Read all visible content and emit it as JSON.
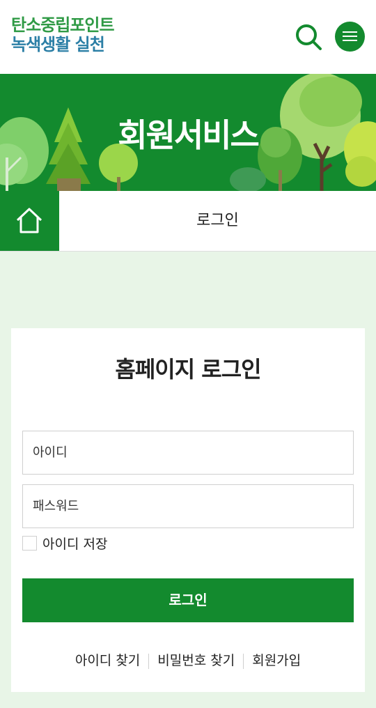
{
  "header": {
    "logo_line1": "탄소중립포인트",
    "logo_line2": "녹색생활 실천",
    "search_icon": "search-icon",
    "menu_icon": "hamburger-menu-icon"
  },
  "banner": {
    "title": "회원서비스"
  },
  "breadcrumb": {
    "home_icon": "home-icon",
    "current": "로그인"
  },
  "login": {
    "title": "홈페이지 로그인",
    "id_placeholder": "아이디",
    "password_placeholder": "패스워드",
    "remember_label": "아이디 저장",
    "submit_label": "로그인",
    "links": [
      "아이디 찾기",
      "비밀번호 찾기",
      "회원가입"
    ]
  },
  "colors": {
    "brand_green": "#138a2e",
    "logo_green": "#2f9a45",
    "logo_blue": "#2c7fa6",
    "page_bg": "#e8f5e7"
  }
}
